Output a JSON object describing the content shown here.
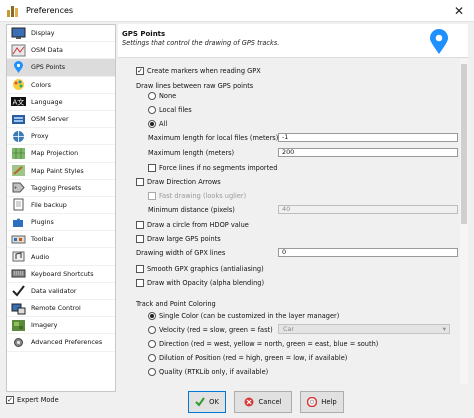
{
  "window": {
    "title": "Preferences",
    "close_glyph": "✕"
  },
  "sidebar": {
    "items": [
      {
        "label": "Display",
        "icon": "display-icon"
      },
      {
        "label": "OSM Data",
        "icon": "osm-data-icon"
      },
      {
        "label": "GPS Points",
        "icon": "gps-pin-icon",
        "selected": true
      },
      {
        "label": "Colors",
        "icon": "colors-icon"
      },
      {
        "label": "Language",
        "icon": "language-icon"
      },
      {
        "label": "OSM Server",
        "icon": "osm-server-icon"
      },
      {
        "label": "Proxy",
        "icon": "proxy-icon"
      },
      {
        "label": "Map Projection",
        "icon": "map-projection-icon"
      },
      {
        "label": "Map Paint Styles",
        "icon": "map-paint-icon"
      },
      {
        "label": "Tagging Presets",
        "icon": "tagging-icon"
      },
      {
        "label": "File backup",
        "icon": "file-backup-icon"
      },
      {
        "label": "Plugins",
        "icon": "plugins-icon"
      },
      {
        "label": "Toolbar",
        "icon": "toolbar-icon"
      },
      {
        "label": "Audio",
        "icon": "audio-icon"
      },
      {
        "label": "Keyboard Shortcuts",
        "icon": "keyboard-icon"
      },
      {
        "label": "Data validator",
        "icon": "validator-icon"
      },
      {
        "label": "Remote Control",
        "icon": "remote-icon"
      },
      {
        "label": "Imagery",
        "icon": "imagery-icon"
      },
      {
        "label": "Advanced Preferences",
        "icon": "advanced-icon"
      }
    ]
  },
  "panel": {
    "title": "GPS Points",
    "subtitle": "Settings that control the drawing of GPS tracks.",
    "create_markers": "Create markers when reading GPX",
    "draw_lines_label": "Draw lines between raw GPS points",
    "lines_none": "None",
    "lines_local": "Local files",
    "lines_all": "All",
    "max_length_local_label": "Maximum length for local files (meters)",
    "max_length_local_value": "-1",
    "max_length_label": "Maximum length (meters)",
    "max_length_value": "200",
    "force_lines": "Force lines if no segments imported",
    "draw_arrows": "Draw Direction Arrows",
    "fast_drawing": "Fast drawing (looks uglier)",
    "min_distance_label": "Minimum distance (pixels)",
    "min_distance_value": "40",
    "draw_hdop": "Draw a circle from HDOP value",
    "draw_large": "Draw large GPS points",
    "drawing_width_label": "Drawing width of GPX lines",
    "drawing_width_value": "0",
    "smooth": "Smooth GPX graphics (antialiasing)",
    "opacity": "Draw with Opacity (alpha blending)",
    "coloring_label": "Track and Point Coloring",
    "color_single": "Single Color (can be customized in the layer manager)",
    "color_velocity": "Velocity (red = slow, green = fast)",
    "velocity_select": "Car",
    "color_direction": "Direction (red = west, yellow = north, green = east, blue = south)",
    "color_dilution": "Dilution of Position (red = high, green = low, if available)",
    "color_quality": "Quality (RTKLib only, if available)"
  },
  "footer": {
    "expert_mode": "Expert Mode",
    "ok": "OK",
    "cancel": "Cancel",
    "help": "Help"
  },
  "colors": {
    "accent": "#0078d7",
    "pin": "#1e90ff",
    "ok_green": "#2e9b2e",
    "cancel_red": "#d83b3b"
  }
}
